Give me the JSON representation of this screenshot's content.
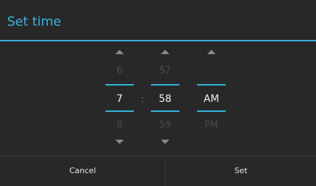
{
  "dialog": {
    "title": "Set time"
  },
  "picker": {
    "hour": {
      "prev": "6",
      "current": "7",
      "next": "8"
    },
    "separator": ":",
    "minute": {
      "prev": "57",
      "current": "58",
      "next": "59"
    },
    "ampm": {
      "prev": "",
      "current": "AM",
      "next": "PM"
    }
  },
  "buttons": {
    "cancel_label": "Cancel",
    "set_label": "Set"
  },
  "colors": {
    "accent": "#33b5e5",
    "background": "#282828"
  }
}
